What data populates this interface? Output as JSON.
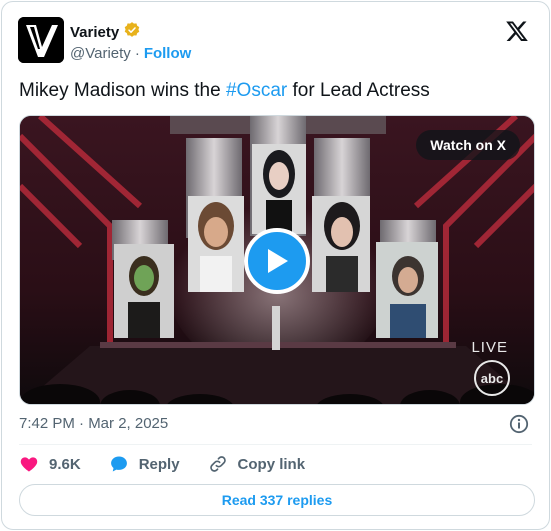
{
  "author": {
    "name": "Variety",
    "handle": "@Variety",
    "separator": "·",
    "follow_label": "Follow",
    "verified_color": "#e8b21c"
  },
  "tweet": {
    "text_before": "Mikey Madison wins the ",
    "hashtag": "#Oscar",
    "text_after": " for Lead Actress"
  },
  "media": {
    "watch_label": "Watch on X",
    "live_label": "LIVE",
    "network_label": "abc"
  },
  "timestamp": "7:42 PM · Mar 2, 2025",
  "actions": {
    "like_count": "9.6K",
    "reply_label": "Reply",
    "copy_link_label": "Copy link"
  },
  "read_replies_label": "Read 337 replies",
  "colors": {
    "accent": "#1d9bf0",
    "like": "#f91880",
    "text_secondary": "#536471"
  }
}
